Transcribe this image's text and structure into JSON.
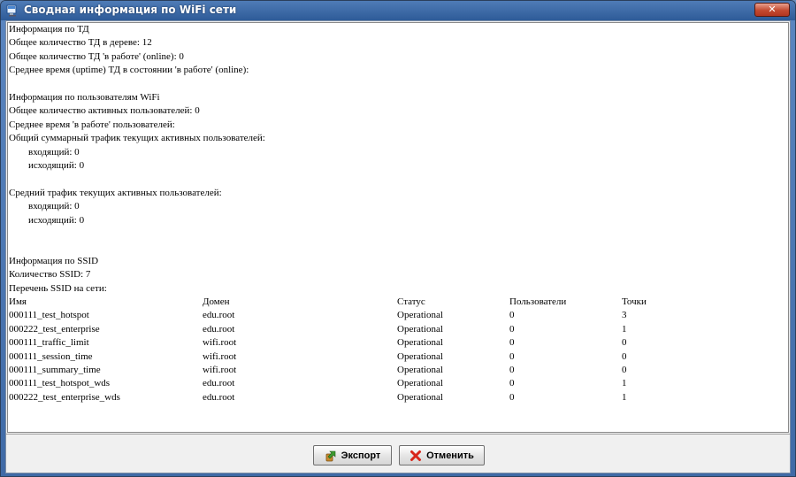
{
  "window": {
    "title": "Сводная информация по WiFi сети",
    "close_label": "✕"
  },
  "report": {
    "lines": [
      "Информация по ТД",
      "Общее количество ТД в дереве: 12",
      "Общее количество ТД 'в работе' (online): 0",
      "Среднее время (uptime) ТД в состоянии 'в работе' (online):",
      "",
      "Информация по пользователям WiFi",
      "Общее количество активных пользователей: 0",
      "Среднее время 'в работе' пользователей:",
      "Общий суммарный трафик текущих активных пользователей:",
      "        входящий: 0",
      "        исходящий: 0",
      "",
      "Средний трафик текущих активных пользователей:",
      "        входящий: 0",
      "        исходящий: 0",
      "",
      "",
      "Информация по SSID",
      "Количество SSID: 7",
      "Перечень SSID на сети:"
    ],
    "ssid_table": {
      "headers": [
        "Имя",
        "Домен",
        "Статус",
        "Пользователи",
        "Точки"
      ],
      "rows": [
        [
          "000111_test_hotspot",
          "edu.root",
          "Operational",
          "0",
          "3"
        ],
        [
          "000222_test_enterprise",
          "edu.root",
          "Operational",
          "0",
          "1"
        ],
        [
          "000111_traffic_limit",
          "wifi.root",
          "Operational",
          "0",
          "0"
        ],
        [
          "000111_session_time",
          "wifi.root",
          "Operational",
          "0",
          "0"
        ],
        [
          "000111_summary_time",
          "wifi.root",
          "Operational",
          "0",
          "0"
        ],
        [
          "000111_test_hotspot_wds",
          "edu.root",
          "Operational",
          "0",
          "1"
        ],
        [
          "000222_test_enterprise_wds",
          "edu.root",
          "Operational",
          "0",
          "1"
        ]
      ]
    }
  },
  "buttons": {
    "export_label": "Экспорт",
    "cancel_label": "Отменить"
  }
}
